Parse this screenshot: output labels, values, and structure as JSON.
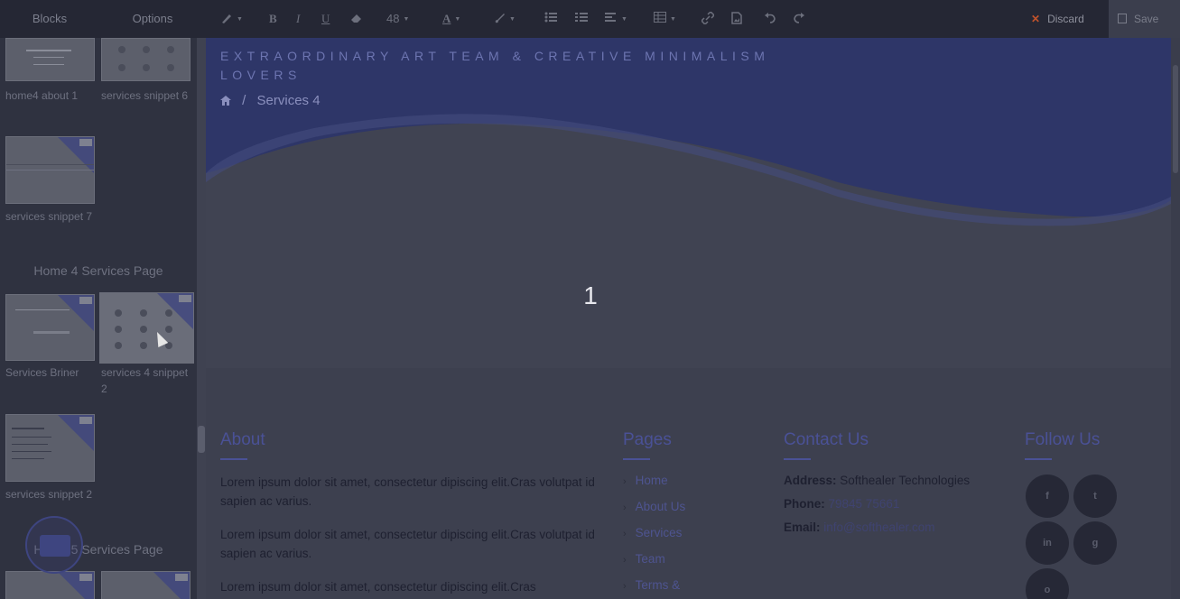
{
  "topbar": {
    "tabs": [
      "Blocks",
      "Options"
    ],
    "toolbar": {
      "font_size": "48",
      "bold_glyph": "B",
      "italic_glyph": "I",
      "underline_glyph": "U",
      "text_color_glyph": "A"
    },
    "discard_label": "Discard",
    "save_label": "Save"
  },
  "sidebar": {
    "snippets": [
      {
        "caption": "home4 about 1"
      },
      {
        "caption": "services snippet 6"
      },
      {
        "caption": "services snippet 7"
      },
      {
        "caption": "Services Briner"
      },
      {
        "caption": "services 4 snippet 2"
      },
      {
        "caption": "services snippet 2"
      }
    ],
    "sections": [
      "Home 4 Services Page",
      "Home 5 Services Page"
    ]
  },
  "page": {
    "tagline": "EXTRAORDINARY ART TEAM & CREATIVE MINIMALISM LOVERS",
    "breadcrumb": {
      "separator": "/",
      "current": "Services 4"
    },
    "overlay_number": "1",
    "footer": {
      "about": {
        "heading": "About",
        "paragraphs": [
          "Lorem ipsum dolor sit amet, consectetur dipiscing elit.Cras volutpat id sapien ac varius.",
          "Lorem ipsum dolor sit amet, consectetur dipiscing elit.Cras volutpat id sapien ac varius.",
          "Lorem ipsum dolor sit amet, consectetur dipiscing elit.Cras"
        ]
      },
      "pages": {
        "heading": "Pages",
        "links": [
          "Home",
          "About Us",
          "Services",
          "Team",
          "Terms &"
        ]
      },
      "contact": {
        "heading": "Contact Us",
        "address_label": "Address:",
        "address": "Softhealer Technologies",
        "phone_label": "Phone:",
        "phone": "79845 75661",
        "email_label": "Email:",
        "email": "info@softhealer.com"
      },
      "follow": {
        "heading": "Follow Us",
        "icons": [
          "facebook-icon",
          "twitter-icon",
          "linkedin-icon",
          "github-icon",
          "instagram-icon"
        ],
        "glyphs": [
          "f",
          "t",
          "in",
          "g",
          "o"
        ]
      }
    }
  },
  "colors": {
    "hero_blue": "#2e3668",
    "accent": "#4a5196",
    "discard_x": "#c0522b"
  }
}
